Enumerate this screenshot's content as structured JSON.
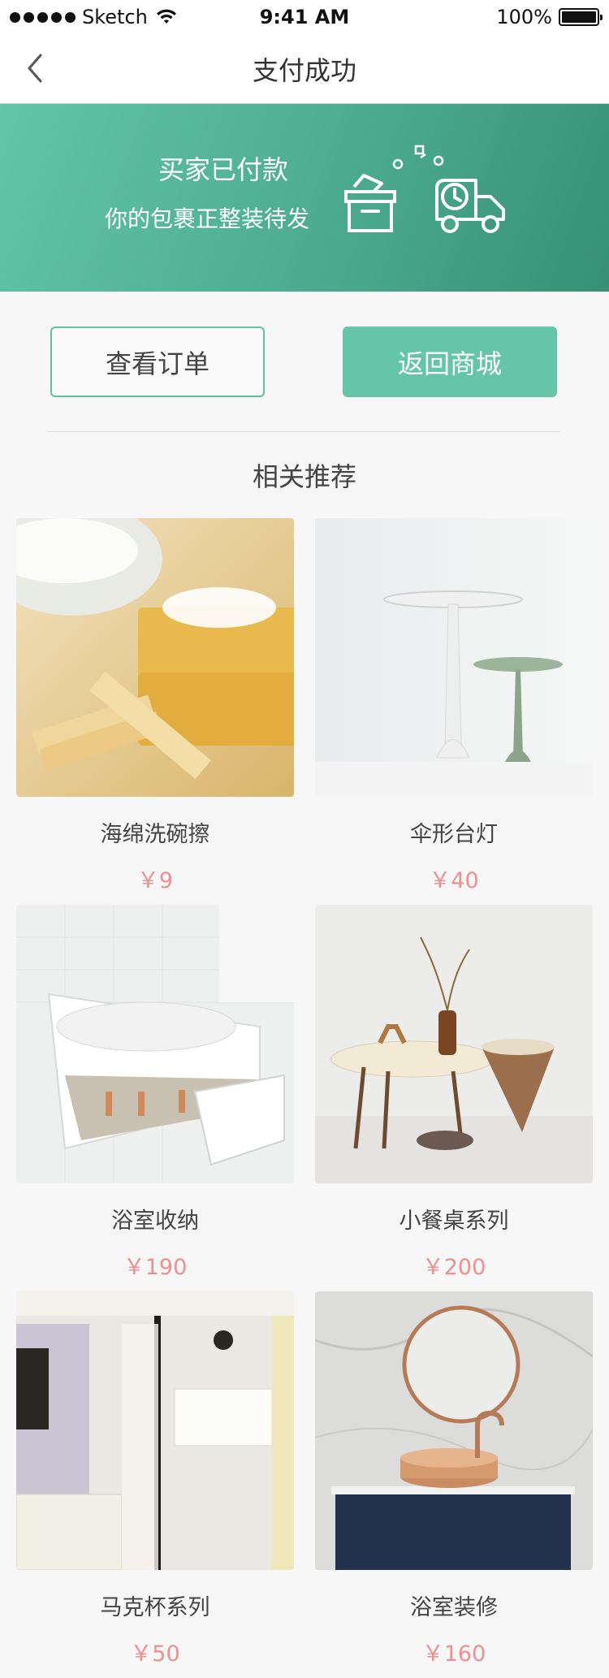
{
  "status_bar": {
    "carrier": "Sketch",
    "time": "9:41 AM",
    "battery": "100%"
  },
  "nav": {
    "title": "支付成功"
  },
  "banner": {
    "title": "买家已付款",
    "subtitle": "你的包裹正整装待发"
  },
  "actions": {
    "view_order": "查看订单",
    "back_to_shop": "返回商城"
  },
  "section": {
    "title": "相关推荐"
  },
  "products": [
    {
      "name": "海绵洗碗擦",
      "price": "￥9"
    },
    {
      "name": "伞形台灯",
      "price": "￥40"
    },
    {
      "name": "浴室收纳",
      "price": "￥190"
    },
    {
      "name": "小餐桌系列",
      "price": "￥200"
    },
    {
      "name": "马克杯系列",
      "price": "￥50"
    },
    {
      "name": "浴室装修",
      "price": "￥160"
    }
  ],
  "colors": {
    "accent": "#64c6a6",
    "price": "#f08f8f"
  }
}
